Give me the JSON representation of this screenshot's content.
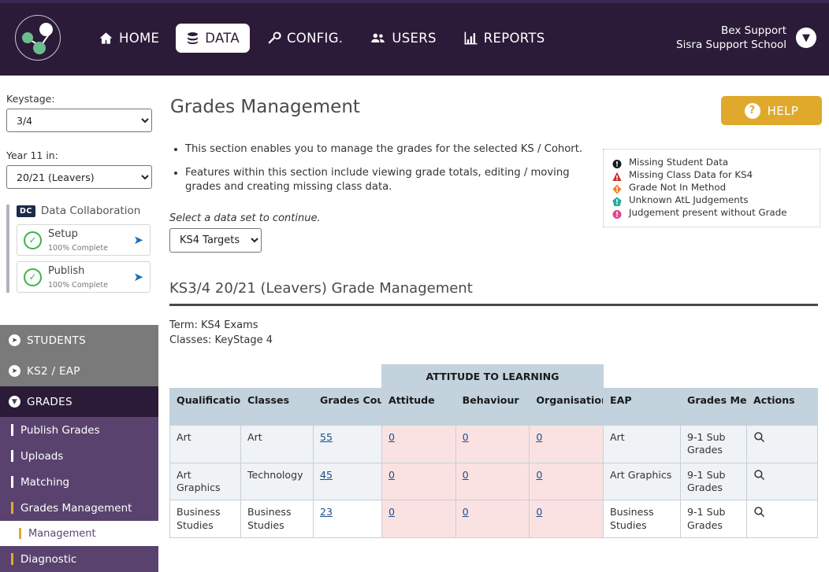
{
  "topnav": {
    "logo_name": "sisra-logo",
    "items": [
      {
        "label": "HOME",
        "icon": "home-icon",
        "active": false
      },
      {
        "label": "DATA",
        "icon": "database-icon",
        "active": true
      },
      {
        "label": "CONFIG.",
        "icon": "wrench-icon",
        "active": false
      },
      {
        "label": "USERS",
        "icon": "users-icon",
        "active": false
      },
      {
        "label": "REPORTS",
        "icon": "bar-chart-icon",
        "active": false
      }
    ],
    "user_name": "Bex Support",
    "user_school": "Sisra Support School",
    "caret_icon": "chevron-down-icon"
  },
  "sidebar": {
    "keystage_label": "Keystage:",
    "keystage_value": "3/4",
    "year_label": "Year 11 in:",
    "year_value": "20/21 (Leavers)",
    "dc_badge": "DC",
    "dc_title": "Data Collaboration",
    "dc_cards": [
      {
        "title": "Setup",
        "sub": "100% Complete"
      },
      {
        "title": "Publish",
        "sub": "100% Complete"
      }
    ],
    "sections": [
      {
        "label": "STUDENTS",
        "style": "grey"
      },
      {
        "label": "KS2 / EAP",
        "style": "grey"
      },
      {
        "label": "GRADES",
        "style": "dark"
      }
    ],
    "grades_sub": [
      {
        "label": "Publish Grades",
        "current": false
      },
      {
        "label": "Uploads",
        "current": false
      },
      {
        "label": "Matching",
        "current": false
      },
      {
        "label": "Grades Management",
        "current": true
      }
    ],
    "grades_sub2": [
      {
        "label": "Management"
      },
      {
        "label": "Diagnostic"
      }
    ]
  },
  "main": {
    "page_title": "Grades Management",
    "help_label": "HELP",
    "bullets": [
      "This section enables you to manage the grades for the selected KS / Cohort.",
      "Features within this section include viewing grade totals, editing / moving grades and creating missing class data."
    ],
    "legend": [
      {
        "text": "Missing Student Data",
        "color": "#1a1a1a",
        "shape": "circle"
      },
      {
        "text": "Missing Class Data for KS4",
        "color": "#d32b2b",
        "shape": "triangle"
      },
      {
        "text": "Grade Not In Method",
        "color": "#f08023",
        "shape": "diamond"
      },
      {
        "text": "Unknown AtL Judgements",
        "color": "#1fae9e",
        "shape": "pentagon"
      },
      {
        "text": "Judgement present without Grade",
        "color": "#e8458f",
        "shape": "circle"
      }
    ],
    "dataset_label": "Select a data set to continue.",
    "dataset_value": "KS4 Targets",
    "section_title": "KS3/4 20/21 (Leavers) Grade Management",
    "term_line": "Term: KS4 Exams",
    "classes_line": "Classes: KeyStage 4"
  },
  "table": {
    "group_header": "ATTITUDE TO LEARNING",
    "columns": [
      "Qualification Name",
      "Classes",
      "Grades Count",
      "Attitude",
      "Behaviour",
      "Organisation",
      "EAP",
      "Grades Method",
      "Actions"
    ],
    "rows": [
      {
        "qualification": "Art",
        "classes": "Art",
        "count": "55",
        "attitude": "0",
        "behaviour": "0",
        "organisation": "0",
        "eap": "Art",
        "method": "9-1 Sub Grades",
        "action_icon": "search-icon"
      },
      {
        "qualification": "Art Graphics",
        "classes": "Technology",
        "count": "45",
        "attitude": "0",
        "behaviour": "0",
        "organisation": "0",
        "eap": "Art Graphics",
        "method": "9-1 Sub Grades",
        "action_icon": "search-icon"
      },
      {
        "qualification": "Business Studies",
        "classes": "Business Studies",
        "count": "23",
        "attitude": "0",
        "behaviour": "0",
        "organisation": "0",
        "eap": "Business Studies",
        "method": "9-1 Sub Grades",
        "action_icon": "search-icon"
      }
    ]
  }
}
